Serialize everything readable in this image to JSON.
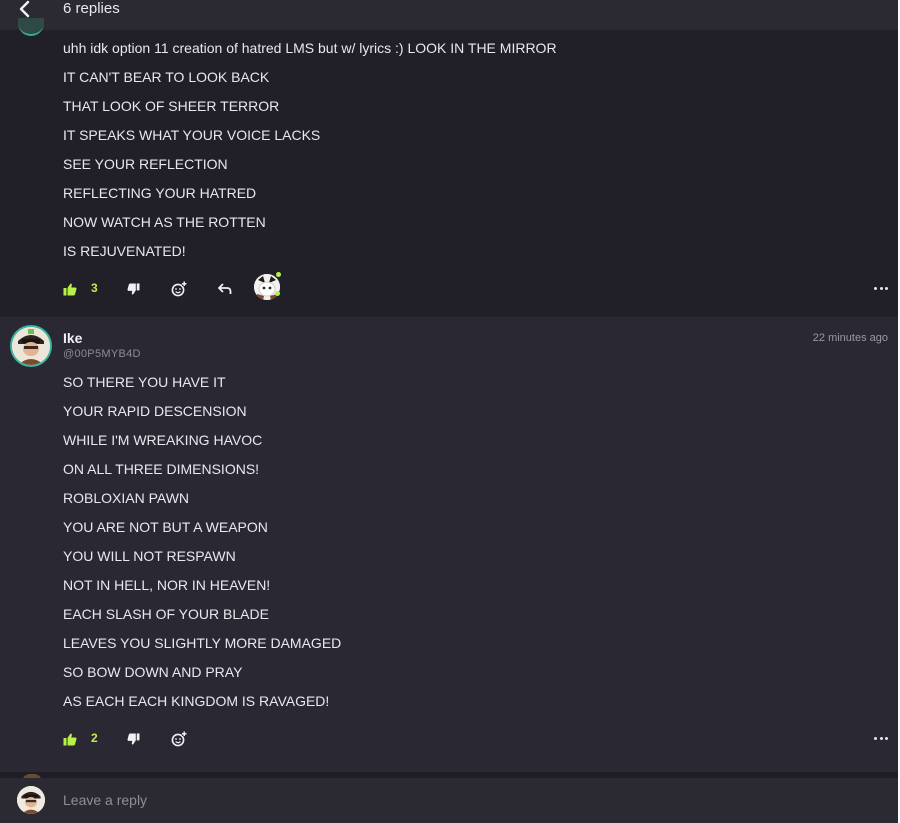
{
  "header": {
    "title": "6 replies",
    "back_icon": "chevron-left-icon"
  },
  "comments": [
    {
      "lines": [
        "uhh idk option 11 creation of hatred LMS but w/ lyrics :) LOOK IN THE MIRROR",
        "IT CAN'T BEAR TO LOOK BACK",
        "THAT LOOK OF SHEER TERROR",
        "IT SPEAKS WHAT YOUR VOICE LACKS",
        "SEE YOUR REFLECTION",
        "REFLECTING YOUR HATRED",
        "NOW WATCH AS THE ROTTEN",
        "IS REJUVENATED!"
      ],
      "likes": "3"
    },
    {
      "author": "Ike",
      "handle": "@00P5MYB4D",
      "time": "22 minutes ago",
      "lines": [
        "SO THERE YOU HAVE IT",
        "YOUR RAPID DESCENSION",
        "WHILE I'M WREAKING HAVOC",
        "ON ALL THREE DIMENSIONS!",
        "ROBLOXIAN PAWN",
        "YOU ARE NOT BUT A WEAPON",
        "YOU WILL NOT RESPAWN",
        "NOT IN HELL, NOR IN HEAVEN!",
        "EACH SLASH OF YOUR BLADE",
        "LEAVES YOU SLIGHTLY MORE DAMAGED",
        "SO BOW DOWN AND PRAY",
        "AS EACH EACH KINGDOM IS RAVAGED!"
      ],
      "likes": "2"
    }
  ],
  "reply_box": {
    "placeholder": "Leave a reply"
  },
  "colors": {
    "accent": "#b8f04a",
    "header_bg": "#2b2a33",
    "comment_bg": "#211f28",
    "comment_alt_bg": "#2a2933",
    "text": "#e9e8ee",
    "muted": "#8d8b96"
  },
  "icons": {
    "like": "thumbs-up-icon",
    "dislike": "thumbs-down-icon",
    "react": "add-reaction-icon",
    "reply": "reply-arrow-icon",
    "more": "more-horizontal-icon"
  }
}
